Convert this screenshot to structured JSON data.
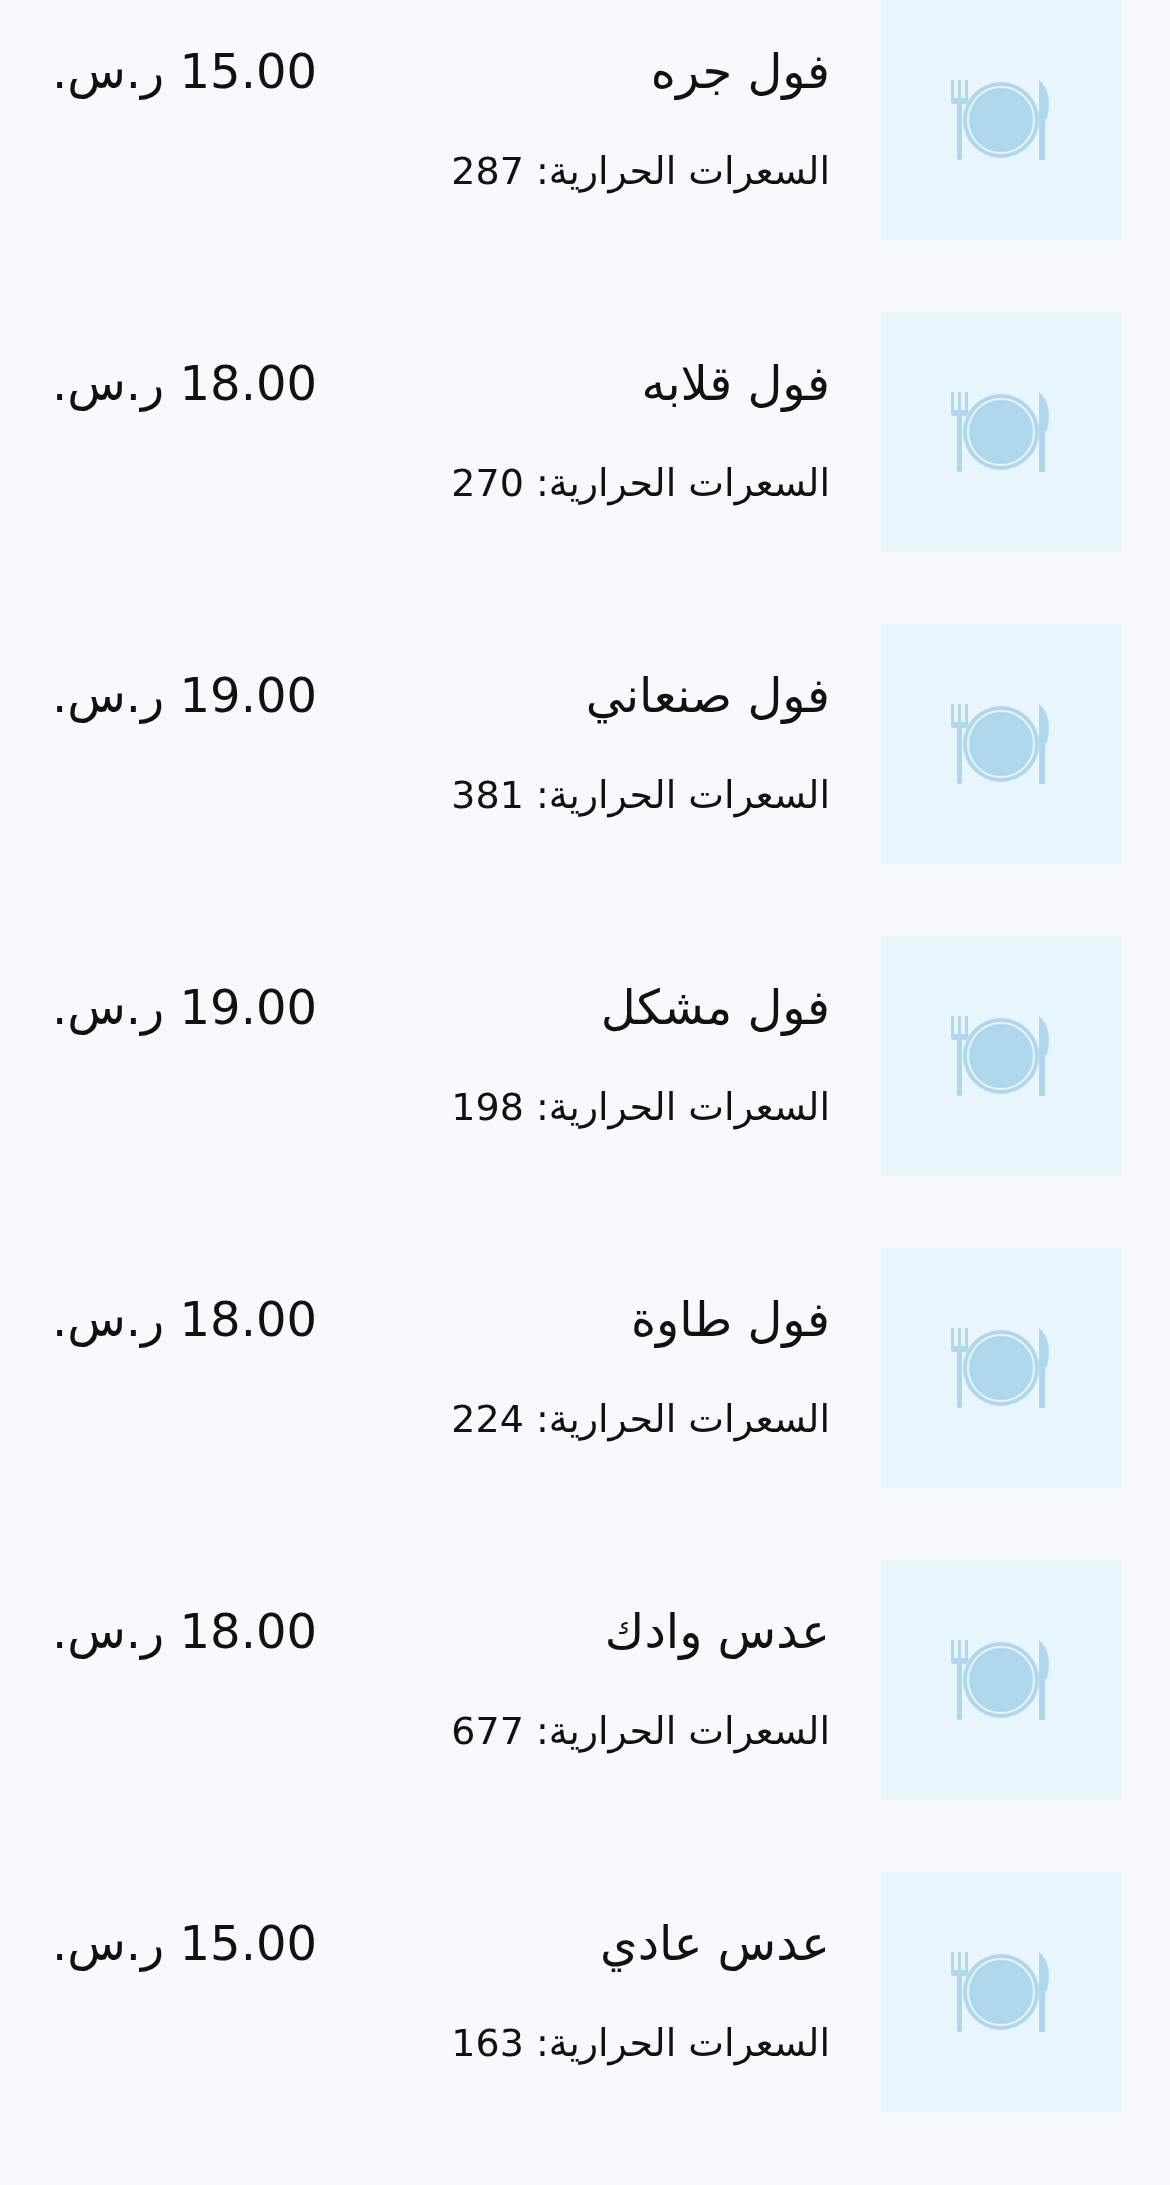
{
  "menu_items": [
    {
      "name": "فول جره",
      "calories": "السعرات الحرارية: 287",
      "price": "15.00 ر.س."
    },
    {
      "name": "فول قلابه",
      "calories": "السعرات الحرارية: 270",
      "price": "18.00 ر.س."
    },
    {
      "name": "فول صنعاني",
      "calories": "السعرات الحرارية: 381",
      "price": "19.00 ر.س."
    },
    {
      "name": "فول مشكل",
      "calories": "السعرات الحرارية: 198",
      "price": "19.00 ر.س."
    },
    {
      "name": "فول طاوة",
      "calories": "السعرات الحرارية: 224",
      "price": "18.00 ر.س."
    },
    {
      "name": "عدس وادك",
      "calories": "السعرات الحرارية: 677",
      "price": "18.00 ر.س."
    },
    {
      "name": "عدس عادي",
      "calories": "السعرات الحرارية: 163",
      "price": "15.00 ر.س."
    }
  ]
}
